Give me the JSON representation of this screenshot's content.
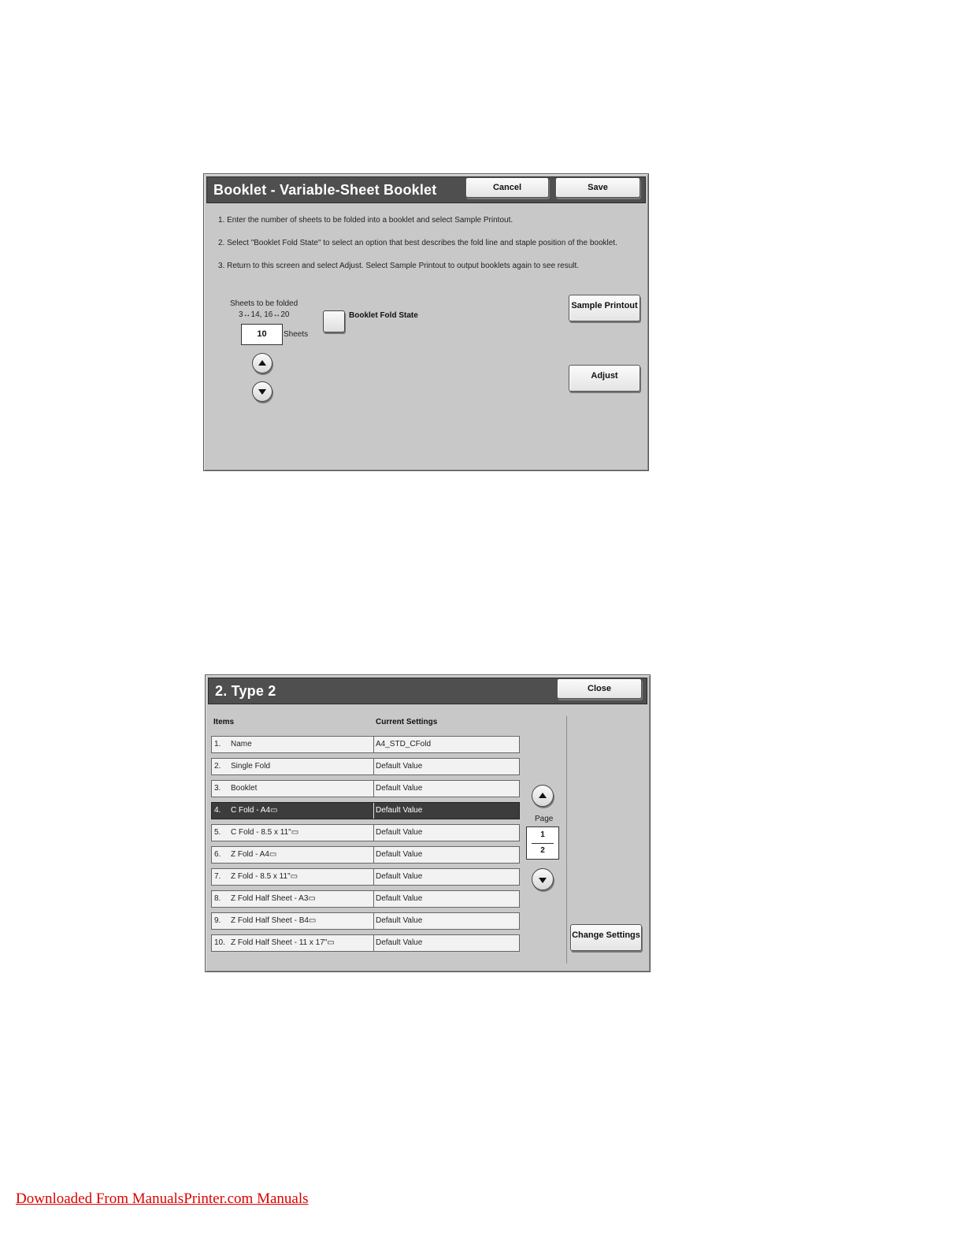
{
  "booklet_screen": {
    "title": "Booklet - Variable-Sheet Booklet",
    "cancel_label": "Cancel",
    "save_label": "Save",
    "instructions": [
      "1. Enter the number of sheets to be folded into a booklet and select Sample Printout.",
      "2. Select \"Booklet Fold State\" to select an option that best describes the fold line and staple position of the booklet.",
      "3. Return to this screen and select Adjust. Select Sample Printout to output booklets again to see result."
    ],
    "sheets_label": "Sheets to be folded",
    "sheets_range": "3↔14, 16↔20",
    "sheets_value": "10",
    "sheets_unit": "Sheets",
    "fold_state_label": "Booklet Fold State",
    "sample_printout_label": "Sample Printout",
    "adjust_label": "Adjust"
  },
  "type_screen": {
    "title": "2. Type 2",
    "close_label": "Close",
    "col_items": "Items",
    "col_current": "Current Settings",
    "rows": [
      {
        "num": "1.",
        "name": "Name",
        "value": "A4_STD_CFold",
        "selected": false
      },
      {
        "num": "2.",
        "name": "Single Fold",
        "value": "Default Value",
        "selected": false
      },
      {
        "num": "3.",
        "name": "Booklet",
        "value": "Default Value",
        "selected": false
      },
      {
        "num": "4.",
        "name": "C Fold - A4▭",
        "value": "Default Value",
        "selected": true
      },
      {
        "num": "5.",
        "name": "C Fold - 8.5 x 11\"▭",
        "value": "Default Value",
        "selected": false
      },
      {
        "num": "6.",
        "name": "Z Fold - A4▭",
        "value": "Default Value",
        "selected": false
      },
      {
        "num": "7.",
        "name": "Z Fold - 8.5 x 11\"▭",
        "value": "Default Value",
        "selected": false
      },
      {
        "num": "8.",
        "name": "Z Fold Half Sheet - A3▭",
        "value": "Default Value",
        "selected": false
      },
      {
        "num": "9.",
        "name": "Z Fold Half Sheet - B4▭",
        "value": "Default Value",
        "selected": false
      },
      {
        "num": "10.",
        "name": "Z Fold Half Sheet - 11 x 17\"▭",
        "value": "Default Value",
        "selected": false
      }
    ],
    "page_label": "Page",
    "page_current": "1",
    "page_total": "2",
    "change_settings_label": "Change Settings"
  },
  "footer": {
    "link_text": "Downloaded From ManualsPrinter.com Manuals"
  }
}
